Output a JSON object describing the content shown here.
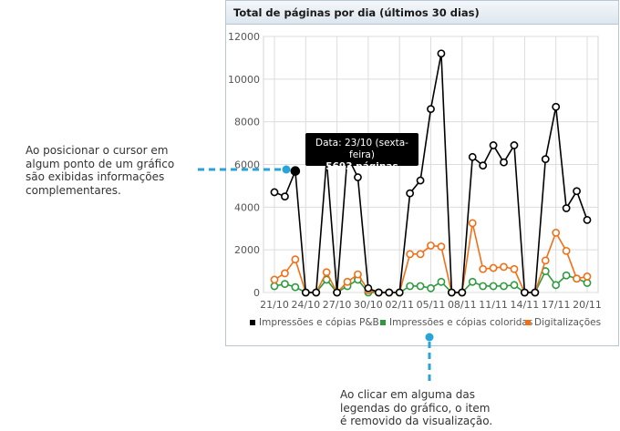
{
  "panel": {
    "title": "Total de páginas por dia (últimos 30 dias)"
  },
  "callouts": {
    "left": [
      "Ao posicionar o cursor em",
      "algum ponto de um gráfico",
      "são exibidas informações",
      "complementares."
    ],
    "bottom": [
      "Ao clicar em alguma das",
      "legendas do gráfico, o item",
      "é removido da visualização."
    ]
  },
  "tooltip": {
    "line1": "Data: 23/10 (sexta-feira)",
    "line2": "5693 páginas"
  },
  "colors": {
    "accent": "#29a3d8",
    "bw": "#000000",
    "color": "#2e9b3f",
    "scan": "#f07018"
  },
  "chart_data": {
    "type": "line",
    "categories": [
      "21/10",
      "22/10",
      "23/10",
      "24/10",
      "25/10",
      "26/10",
      "27/10",
      "28/10",
      "29/10",
      "30/10",
      "31/10",
      "01/11",
      "02/11",
      "03/11",
      "04/11",
      "05/11",
      "06/11",
      "07/11",
      "08/11",
      "09/11",
      "10/11",
      "11/11",
      "12/11",
      "13/11",
      "14/11",
      "15/11",
      "16/11",
      "17/11",
      "18/11",
      "19/11",
      "20/11"
    ],
    "x_tick_labels": [
      "21/10",
      "24/10",
      "27/10",
      "30/10",
      "02/11",
      "05/11",
      "08/11",
      "11/11",
      "14/11",
      "17/11",
      "20/11"
    ],
    "y_ticks": [
      "0",
      "2000",
      "4000",
      "6000",
      "8000",
      "10000",
      "12000"
    ],
    "ylim": [
      0,
      12000
    ],
    "grid": true,
    "legend_position": "bottom",
    "highlight_index": 2,
    "series": [
      {
        "name": "Impressões e cópias P&B",
        "key": "bw",
        "values": [
          4700,
          4500,
          5693,
          0,
          0,
          6200,
          0,
          6400,
          5400,
          200,
          0,
          0,
          0,
          4650,
          5250,
          8600,
          11200,
          0,
          0,
          6350,
          5950,
          6900,
          6100,
          6900,
          0,
          0,
          6250,
          8700,
          3950,
          4750,
          3400
        ]
      },
      {
        "name": "Impressões e cópias coloridas",
        "key": "color",
        "values": [
          300,
          400,
          250,
          0,
          0,
          600,
          0,
          300,
          600,
          0,
          0,
          0,
          0,
          300,
          300,
          200,
          500,
          0,
          0,
          500,
          300,
          300,
          300,
          350,
          0,
          0,
          1000,
          350,
          800,
          650,
          450
        ]
      },
      {
        "name": "Digitalizações",
        "key": "scan",
        "values": [
          600,
          900,
          1550,
          0,
          0,
          950,
          0,
          500,
          850,
          100,
          0,
          0,
          0,
          1800,
          1800,
          2200,
          2150,
          0,
          0,
          3250,
          1100,
          1150,
          1200,
          1100,
          0,
          0,
          1500,
          2800,
          1950,
          650,
          750
        ]
      }
    ]
  }
}
